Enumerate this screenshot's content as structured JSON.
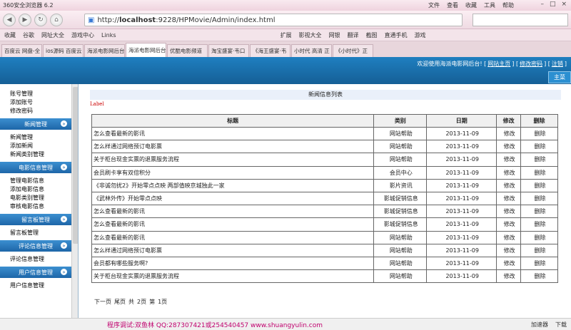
{
  "browser": {
    "app_title": "360安全浏览器 6.2",
    "menu": [
      "文件",
      "查看",
      "收藏",
      "工具",
      "帮助"
    ],
    "url_prefix": "http://",
    "url_host": "localhost",
    "url_rest": ":9228/HPMovie/Admin/index.html",
    "bookmarks": [
      "收藏",
      "谷歌",
      "网址大全",
      "游戏中心",
      "Links"
    ],
    "bookmarks_right": [
      "扩展",
      "影视大全",
      "网银",
      "翻译",
      "截图",
      "直通手机",
      "游戏"
    ],
    "tabs": [
      "百度云 网盘-全",
      "ios源码 百度云",
      "海派电影网后台",
      "海派电影网后台",
      "优酷电影频道",
      "淘宝盛宴·韦口",
      "《海王盛宴·韦",
      "小时代 高清 正",
      "《小时代》正"
    ],
    "active_tab": 3,
    "status": [
      "加速器",
      "下载"
    ]
  },
  "header": {
    "welcome": "欢迎使用海派电影网后台!",
    "links": [
      "网站主页",
      "修改密码",
      "注销"
    ],
    "main_button": "主菜"
  },
  "sidebar": {
    "top_items": [
      "账号管理",
      "添加账号",
      "修改密码"
    ],
    "sections": [
      {
        "title": "新闻管理",
        "items": [
          "新闻管理",
          "添加新闻",
          "新闻类别管理"
        ]
      },
      {
        "title": "电影信息管理",
        "items": [
          "管理电影信息",
          "添加电影信息",
          "电影类别管理",
          "审核电影信息"
        ]
      },
      {
        "title": "留言板管理",
        "items": [
          "留言板管理"
        ]
      },
      {
        "title": "评论信息管理",
        "items": [
          "评论信息管理"
        ]
      },
      {
        "title": "用户信息管理",
        "items": [
          "用户信息管理"
        ]
      }
    ]
  },
  "main": {
    "title": "新闻信息列表",
    "label": "Label",
    "columns": [
      "标题",
      "类别",
      "日期",
      "修改",
      "删除"
    ],
    "rows": [
      [
        "怎么查看最新的影讯",
        "网站帮助",
        "2013-11-09",
        "修改",
        "删除"
      ],
      [
        "怎么样通过网络预订电影票",
        "网站帮助",
        "2013-11-09",
        "修改",
        "删除"
      ],
      [
        "关于柜台现金实票的退票服务流程",
        "网站帮助",
        "2013-11-09",
        "修改",
        "删除"
      ],
      [
        "会员刷卡享有双倍积分",
        "会员中心",
        "2013-11-09",
        "修改",
        "删除"
      ],
      [
        "《非诚勿扰2》开始零点点映 两部值映京城独此一家",
        "影片资讯",
        "2013-11-09",
        "修改",
        "删除"
      ],
      [
        "《武林外传》开始零点点映",
        "影城促销信息",
        "2013-11-09",
        "修改",
        "删除"
      ],
      [
        "怎么查看最新的影讯",
        "影城促销信息",
        "2013-11-09",
        "修改",
        "删除"
      ],
      [
        "怎么查看最新的影讯",
        "影城促销信息",
        "2013-11-09",
        "修改",
        "删除"
      ],
      [
        "怎么查看最新的影讯",
        "网站帮助",
        "2013-11-09",
        "修改",
        "删除"
      ],
      [
        "怎么样通过网络预订电影票",
        "网站帮助",
        "2013-11-09",
        "修改",
        "删除"
      ],
      [
        "会员都有哪些服务啊?",
        "网站帮助",
        "2013-11-09",
        "修改",
        "删除"
      ],
      [
        "关于柜台现金实票的退票服务流程",
        "网站帮助",
        "2013-11-09",
        "修改",
        "删除"
      ]
    ],
    "pager": [
      "下一页",
      "尾页",
      "共",
      "2页",
      "第",
      "1页"
    ]
  },
  "footer": {
    "credit": "程序调试:双鱼林 QQ:287307421或254540457 www.shuangyulin.com"
  },
  "colors": {
    "header_blue": "#1f7fc0",
    "sidebar_head": "#1d66a8",
    "credit_pink": "#c0006e"
  }
}
